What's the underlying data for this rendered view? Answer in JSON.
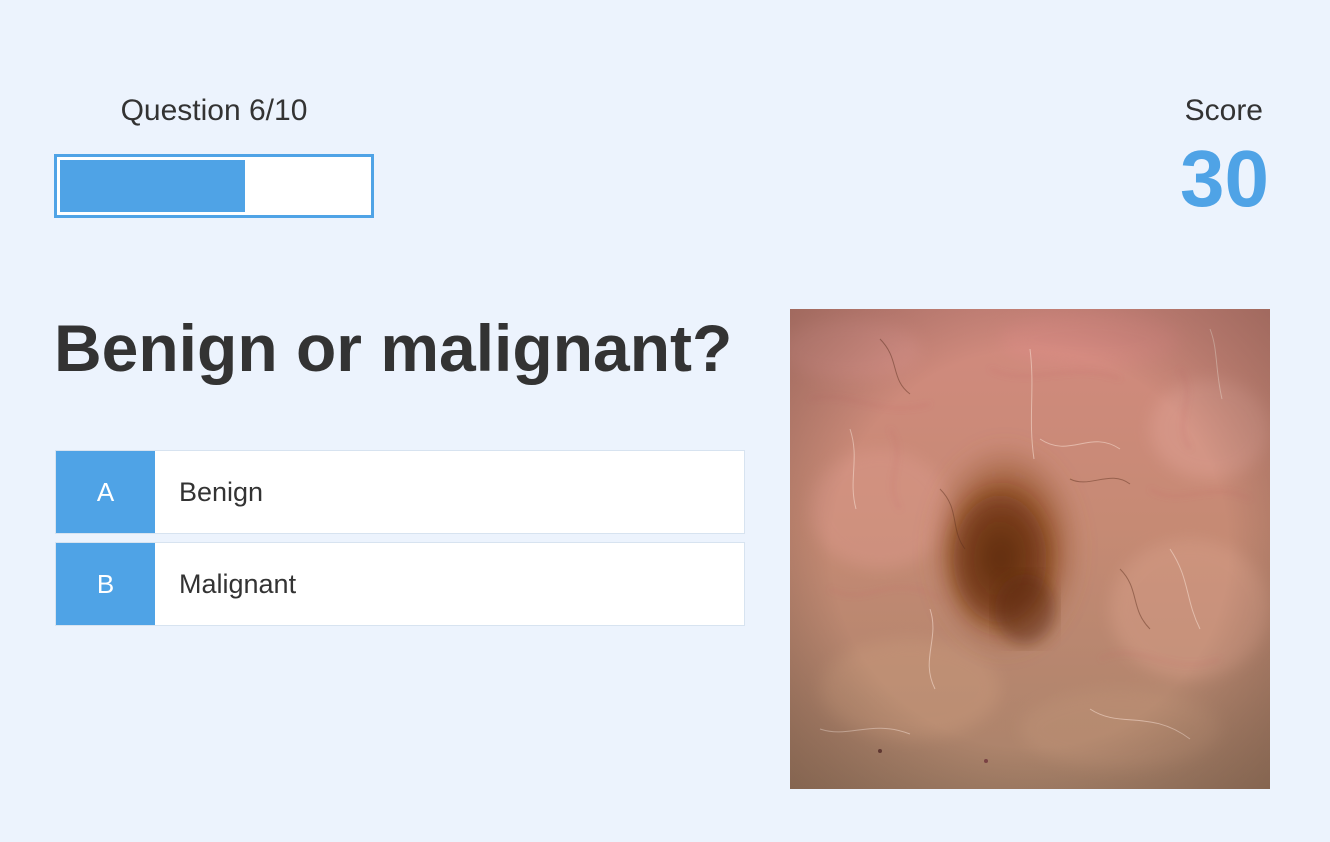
{
  "progress": {
    "label": "Question 6/10",
    "current": 6,
    "total": 10,
    "fill_fraction": 0.6,
    "color": "#4fa3e6"
  },
  "score": {
    "label": "Score",
    "value": "30"
  },
  "question": {
    "title": "Benign or malignant?"
  },
  "answers": [
    {
      "letter": "A",
      "text": "Benign"
    },
    {
      "letter": "B",
      "text": "Malignant"
    }
  ],
  "image": {
    "subject": "dermoscopy image of a pigmented skin lesion"
  },
  "colors": {
    "accent": "#4fa3e6",
    "background": "#ecf3fd",
    "text": "#333333"
  }
}
